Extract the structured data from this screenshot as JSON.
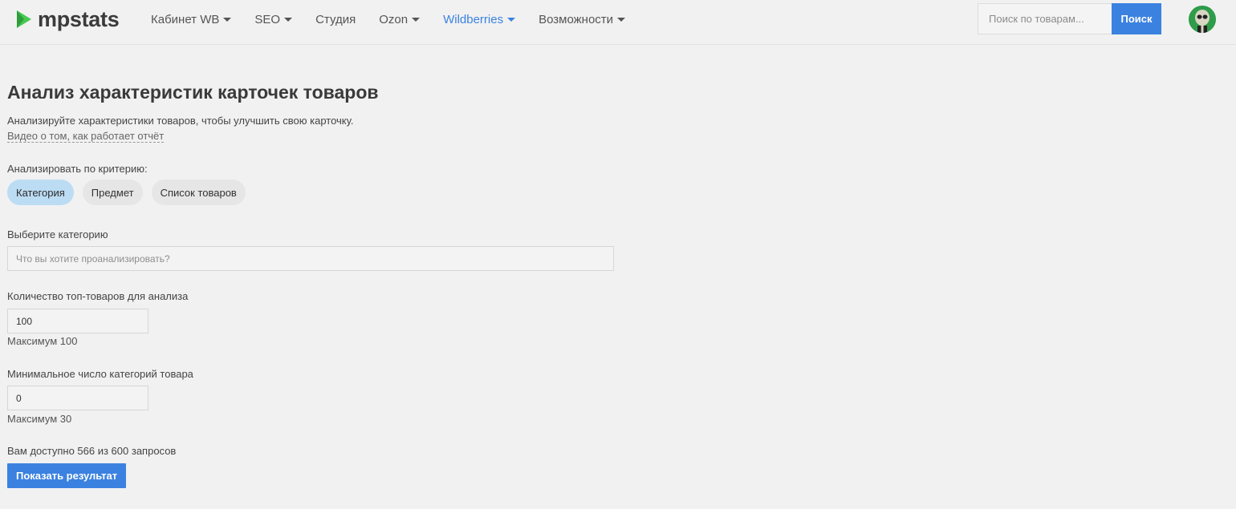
{
  "brand": {
    "name": "mpstats",
    "accent": "#3b82e0",
    "logo_color": "#46c94f"
  },
  "nav": {
    "items": [
      {
        "label": "Кабинет WB",
        "dropdown": true,
        "active": false
      },
      {
        "label": "SEO",
        "dropdown": true,
        "active": false
      },
      {
        "label": "Студия",
        "dropdown": false,
        "active": false
      },
      {
        "label": "Ozon",
        "dropdown": true,
        "active": false
      },
      {
        "label": "Wildberries",
        "dropdown": true,
        "active": true
      },
      {
        "label": "Возможности",
        "dropdown": true,
        "active": false
      }
    ],
    "search_placeholder": "Поиск по товарам...",
    "search_button": "Поиск"
  },
  "page": {
    "title": "Анализ характеристик карточек товаров",
    "description": "Анализируйте характеристики товаров, чтобы улучшить свою карточку.",
    "video_link": "Видео о том, как работает отчёт"
  },
  "criteria": {
    "label": "Анализировать по критерию:",
    "options": [
      "Категория",
      "Предмет",
      "Список товаров"
    ],
    "selected": "Категория"
  },
  "category": {
    "label": "Выберите категорию",
    "placeholder": "Что вы хотите проанализировать?"
  },
  "top_count": {
    "label": "Количество топ-товаров для анализа",
    "value": "100",
    "hint": "Максимум 100"
  },
  "min_categories": {
    "label": "Минимальное число категорий товара",
    "value": "0",
    "hint": "Максимум 30"
  },
  "quota": {
    "text": "Вам доступно 566 из 600 запросов"
  },
  "submit_label": "Показать результат"
}
